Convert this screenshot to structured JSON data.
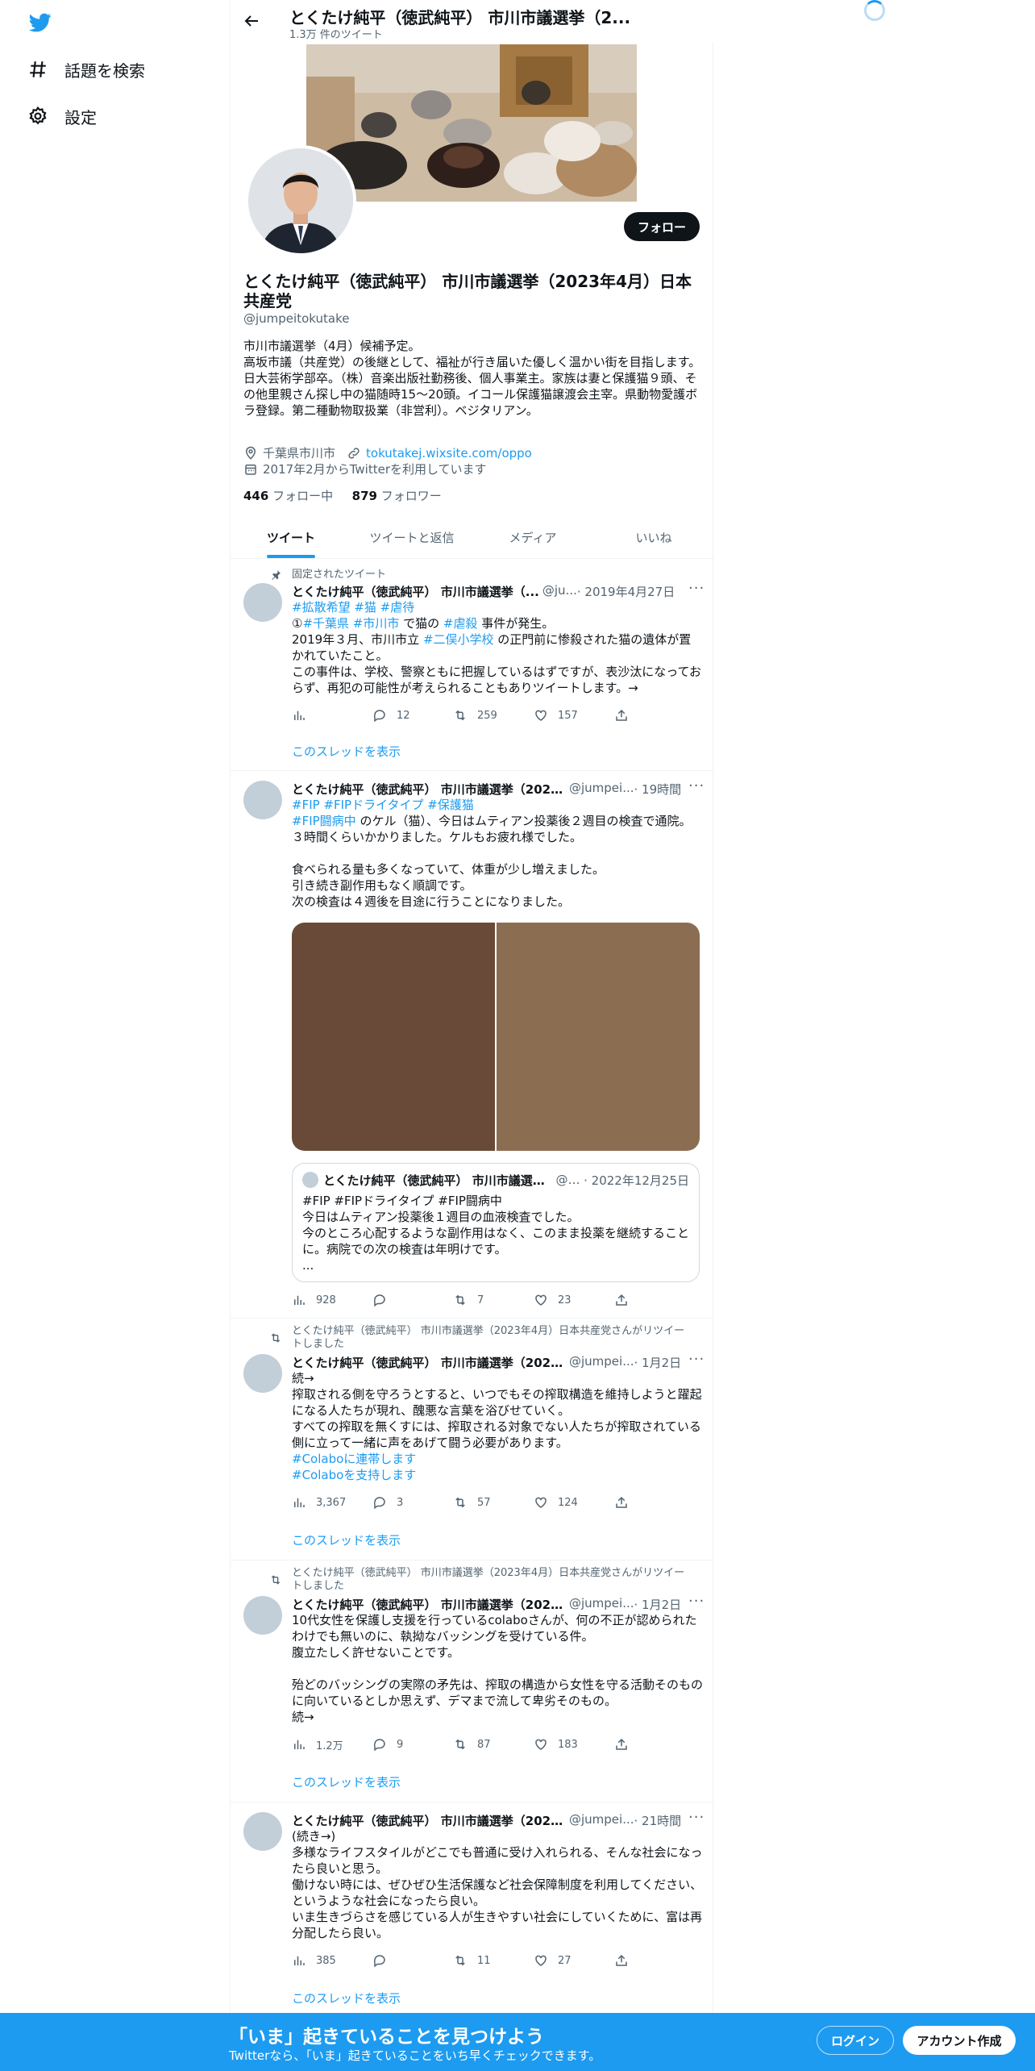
{
  "sidebar": {
    "explore_label": "話題を検索",
    "settings_label": "設定"
  },
  "header": {
    "title": "とくたけ純平（徳武純平） 市川市議選挙（2...",
    "tweet_count": "1.3万 件のツイート"
  },
  "profile": {
    "name": "とくたけ純平（徳武純平） 市川市議選挙（2023年4月）日本共産党",
    "handle": "@jumpeitokutake",
    "follow_label": "フォロー",
    "bio": "市川市議選挙（4月）候補予定。\n高坂市議（共産党）の後継として、福祉が行き届いた優しく温かい街を目指します。\n日大芸術学部卒。（株）音楽出版社勤務後、個人事業主。家族は妻と保護猫９頭、その他里親さん探し中の猫随時15～20頭。イコール保護猫譲渡会主宰。県動物愛護ボラ登録。第二種動物取扱業（非営利）。ベジタリアン。",
    "location": "千葉県市川市",
    "website": "tokutakej.wixsite.com/oppo",
    "joined": "2017年2月からTwitterを利用しています",
    "following_count": "446",
    "following_label": "フォロー中",
    "followers_count": "879",
    "followers_label": "フォロワー"
  },
  "tabs": [
    "ツイート",
    "ツイートと返信",
    "メディア",
    "いいね"
  ],
  "tweets": [
    {
      "context": "固定されたツイート",
      "name": "とくたけ純平（徳武純平） 市川市議選挙（...",
      "handle": "@ju...",
      "date": "· 2019年4月27日",
      "tags_line": "#拡散希望 #猫 #虐待",
      "line1_prefix": "①",
      "line1_tags": "#千葉県 #市川市",
      "line1_mid": " で猫の ",
      "line1_tag2": "#虐殺",
      "line1_suffix": " 事件が発生。",
      "line2_prefix": "2019年３月、市川市立 ",
      "line2_tag": "#二俣小学校",
      "line2_suffix": " の正門前に惨殺された猫の遺体が置かれていたこと。",
      "line3": "この事件は、学校、警察ともに把握しているはずですが、表沙汰になっておらず、再犯の可能性が考えられることもありツイートします。→",
      "views": "",
      "replies": "12",
      "retweets": "259",
      "likes": "157",
      "thread": "このスレッドを表示"
    },
    {
      "name": "とくたけ純平（徳武純平） 市川市議選挙（2023...",
      "handle": "@jumpei...",
      "date": "· 19時間",
      "tags_line": "#FIP #FIPドライタイプ #保護猫",
      "tag_prefix": "#FIP闘病中",
      "text": " のケル（猫）、今日はムティアン投薬後２週目の検査で通院。３時間くらいかかりました。ケルもお疲れ様でした。\n\n食べられる量も多くなっていて、体重が少し増えました。\n引き続き副作用もなく順調です。\n次の検査は４週後を目途に行うことになりました。",
      "quote": {
        "name": "とくたけ純平（徳武純平） 市川市議選挙...",
        "handle": "@j...",
        "date": "· 2022年12月25日",
        "text": "#FIP #FIPドライタイプ #FIP闘病中\n今日はムティアン投薬後１週目の血液検査でした。\n今のところ心配するような副作用はなく、このまま投薬を継続することに。病院での次の検査は年明けです。\n..."
      },
      "views": "928",
      "replies": "",
      "retweets": "7",
      "likes": "23"
    },
    {
      "context": "とくたけ純平（徳武純平） 市川市議選挙（2023年4月）日本共産党さんがリツイートしました",
      "name": "とくたけ純平（徳武純平） 市川市議選挙（2023...",
      "handle": "@jumpei...",
      "date": "· 1月2日",
      "text": "続→\n搾取される側を守ろうとすると、いつでもその搾取構造を維持しようと躍起になる人たちが現れ、醜悪な言葉を浴びせていく。\nすべての搾取を無くすには、搾取される対象でない人たちが搾取されている側に立って一緒に声をあげて闘う必要があります。",
      "tag1": "#Colaboに連帯します",
      "tag2": "#Colaboを支持します",
      "views": "3,367",
      "replies": "3",
      "retweets": "57",
      "likes": "124",
      "thread": "このスレッドを表示"
    },
    {
      "context": "とくたけ純平（徳武純平） 市川市議選挙（2023年4月）日本共産党さんがリツイートしました",
      "name": "とくたけ純平（徳武純平） 市川市議選挙（2023...",
      "handle": "@jumpei...",
      "date": "· 1月2日",
      "text": "10代女性を保護し支援を行っているcolaboさんが、何の不正が認められたわけでも無いのに、執拗なバッシングを受けている件。\n腹立たしく許せないことです。\n\n殆どのバッシングの実際の矛先は、搾取の構造から女性を守る活動そのものに向いているとしか思えず、デマまで流して卑劣そのもの。\n続→",
      "views": "1.2万",
      "replies": "9",
      "retweets": "87",
      "likes": "183",
      "thread": "このスレッドを表示"
    },
    {
      "name": "とくたけ純平（徳武純平） 市川市議選挙（2023...",
      "handle": "@jumpei...",
      "date": "· 21時間",
      "text": "(続き→)\n多様なライフスタイルがどこでも普通に受け入れられる、そんな社会になったら良いと思う。\n働けない時には、ぜひぜひ生活保護など社会保障制度を利用してください、というような社会になったら良い。\nいま生きづらさを感じている人が生きやすい社会にしていくために、富は再分配したら良い。",
      "views": "385",
      "replies": "",
      "retweets": "11",
      "likes": "27",
      "thread": "このスレッドを表示"
    }
  ],
  "bottom_bar": {
    "title": "「いま」起きていることを見つけよう",
    "subtitle": "Twitterなら、「いま」起きていることをいち早くチェックできます。",
    "login_label": "ログイン",
    "signup_label": "アカウント作成"
  },
  "colors": {
    "accent": "#1d9bf0",
    "text": "#0f1419",
    "muted": "#536471"
  }
}
